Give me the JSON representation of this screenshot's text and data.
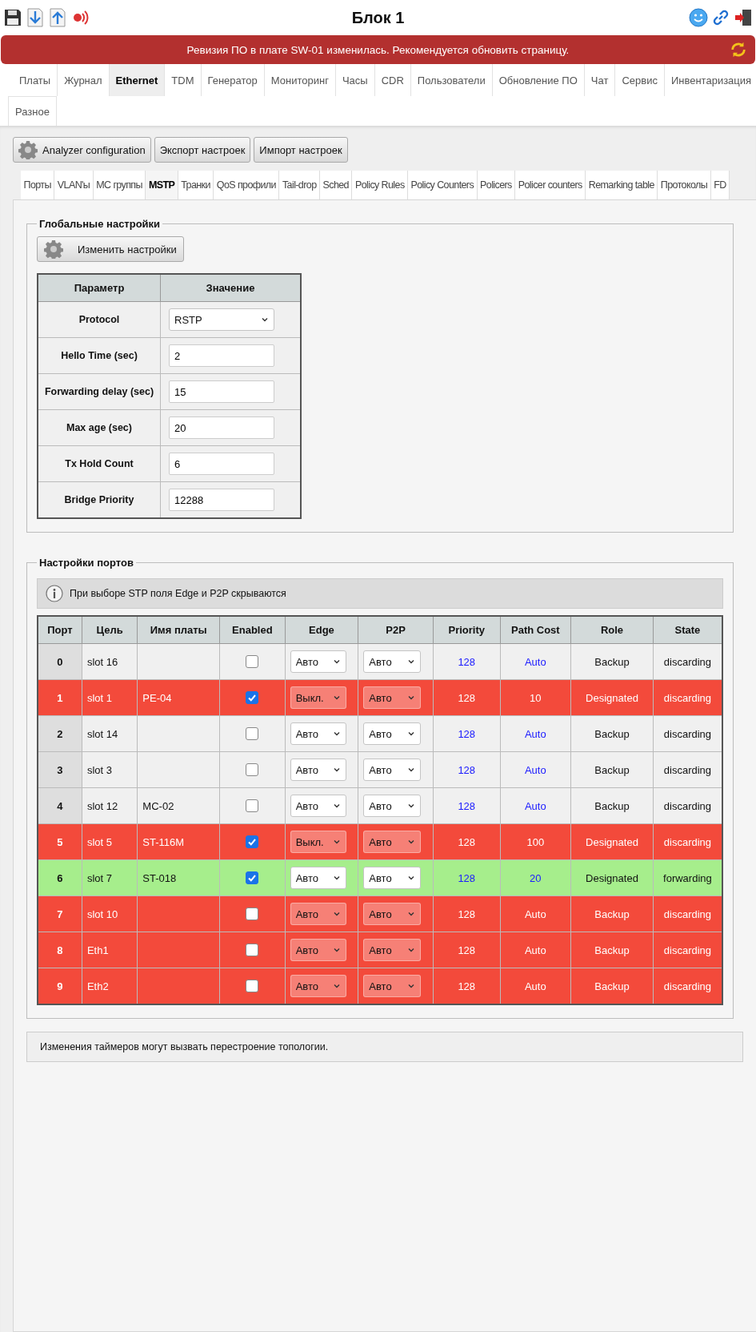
{
  "header": {
    "title": "Блок 1"
  },
  "banner": {
    "text": "Ревизия ПО в плате SW-01 изменилась. Рекомендуется обновить страницу."
  },
  "tabs": [
    {
      "label": "Платы",
      "selected": false
    },
    {
      "label": "Журнал",
      "selected": false
    },
    {
      "label": "Ethernet",
      "selected": true
    },
    {
      "label": "TDM",
      "selected": false
    },
    {
      "label": "Генератор",
      "selected": false
    },
    {
      "label": "Мониторинг",
      "selected": false
    },
    {
      "label": "Часы",
      "selected": false
    },
    {
      "label": "CDR",
      "selected": false
    },
    {
      "label": "Пользователи",
      "selected": false
    },
    {
      "label": "Обновление ПО",
      "selected": false
    },
    {
      "label": "Чат",
      "selected": false
    },
    {
      "label": "Сервис",
      "selected": false
    },
    {
      "label": "Инвентаризация",
      "selected": false
    },
    {
      "label": "Разное",
      "selected": false
    }
  ],
  "toolbar": [
    {
      "label": "Analyzer configuration",
      "icon": true
    },
    {
      "label": "Экспорт настроек",
      "icon": false
    },
    {
      "label": "Импорт настроек",
      "icon": false
    }
  ],
  "sub_tabs": [
    {
      "label": "Порты",
      "selected": false
    },
    {
      "label": "VLAN'ы",
      "selected": false
    },
    {
      "label": "MC группы",
      "selected": false
    },
    {
      "label": "MSTP",
      "selected": true
    },
    {
      "label": "Транки",
      "selected": false
    },
    {
      "label": "QoS профили",
      "selected": false
    },
    {
      "label": "Tail-drop",
      "selected": false
    },
    {
      "label": "Sched",
      "selected": false
    },
    {
      "label": "Policy Rules",
      "selected": false
    },
    {
      "label": "Policy Counters",
      "selected": false
    },
    {
      "label": "Policers",
      "selected": false
    },
    {
      "label": "Policer counters",
      "selected": false
    },
    {
      "label": "Remarking table",
      "selected": false
    },
    {
      "label": "Протоколы",
      "selected": false
    },
    {
      "label": "FD",
      "selected": false
    }
  ],
  "global_settings": {
    "legend": "Глобальные настройки",
    "button": "Изменить настройки",
    "columns": [
      "Параметр",
      "Значение"
    ],
    "rows": [
      {
        "param": "Protocol",
        "kind": "select",
        "value": "RSTP"
      },
      {
        "param": "Hello Time (sec)",
        "kind": "input",
        "value": "2"
      },
      {
        "param": "Forwarding delay (sec)",
        "kind": "input",
        "value": "15"
      },
      {
        "param": "Max age (sec)",
        "kind": "input",
        "value": "20"
      },
      {
        "param": "Tx Hold Count",
        "kind": "input",
        "value": "6"
      },
      {
        "param": "Bridge Priority",
        "kind": "input",
        "value": "12288"
      }
    ]
  },
  "port_settings": {
    "legend": "Настройки портов",
    "info": "При выборе STP поля Edge и P2P скрываются",
    "columns": [
      "Порт",
      "Цель",
      "Имя платы",
      "Enabled",
      "Edge",
      "P2P",
      "Priority",
      "Path Cost",
      "Role",
      "State"
    ],
    "rows": [
      {
        "kind": "normal",
        "port": "0",
        "target": "slot 16",
        "board": "",
        "enabled": false,
        "edge": "Авто",
        "p2p": "Авто",
        "priority": "128",
        "path_cost": "Auto",
        "role": "Backup",
        "state": "discarding"
      },
      {
        "kind": "alarm",
        "port": "1",
        "target": "slot 1",
        "board": "PE-04",
        "enabled": true,
        "edge": "Выкл.",
        "p2p": "Авто",
        "priority": "128",
        "path_cost": "10",
        "role": "Designated",
        "state": "discarding"
      },
      {
        "kind": "normal",
        "port": "2",
        "target": "slot 14",
        "board": "",
        "enabled": false,
        "edge": "Авто",
        "p2p": "Авто",
        "priority": "128",
        "path_cost": "Auto",
        "role": "Backup",
        "state": "discarding"
      },
      {
        "kind": "normal",
        "port": "3",
        "target": "slot 3",
        "board": "",
        "enabled": false,
        "edge": "Авто",
        "p2p": "Авто",
        "priority": "128",
        "path_cost": "Auto",
        "role": "Backup",
        "state": "discarding"
      },
      {
        "kind": "normal",
        "port": "4",
        "target": "slot 12",
        "board": "MC-02",
        "enabled": false,
        "edge": "Авто",
        "p2p": "Авто",
        "priority": "128",
        "path_cost": "Auto",
        "role": "Backup",
        "state": "discarding"
      },
      {
        "kind": "alarm",
        "port": "5",
        "target": "slot 5",
        "board": "ST-116M",
        "enabled": true,
        "edge": "Выкл.",
        "p2p": "Авто",
        "priority": "128",
        "path_cost": "100",
        "role": "Designated",
        "state": "discarding"
      },
      {
        "kind": "ok",
        "port": "6",
        "target": "slot 7",
        "board": "ST-018",
        "enabled": true,
        "edge": "Авто",
        "p2p": "Авто",
        "priority": "128",
        "path_cost": "20",
        "role": "Designated",
        "state": "forwarding"
      },
      {
        "kind": "alarm",
        "port": "7",
        "target": "slot 10",
        "board": "",
        "enabled": false,
        "edge": "Авто",
        "p2p": "Авто",
        "priority": "128",
        "path_cost": "Auto",
        "role": "Backup",
        "state": "discarding"
      },
      {
        "kind": "alarm",
        "port": "8",
        "target": "Eth1",
        "board": "",
        "enabled": false,
        "edge": "Авто",
        "p2p": "Авто",
        "priority": "128",
        "path_cost": "Auto",
        "role": "Backup",
        "state": "discarding"
      },
      {
        "kind": "alarm",
        "port": "9",
        "target": "Eth2",
        "board": "",
        "enabled": false,
        "edge": "Авто",
        "p2p": "Авто",
        "priority": "128",
        "path_cost": "Auto",
        "role": "Backup",
        "state": "discarding"
      }
    ]
  },
  "note": "Изменения таймеров могут вызвать перестроение топологии."
}
